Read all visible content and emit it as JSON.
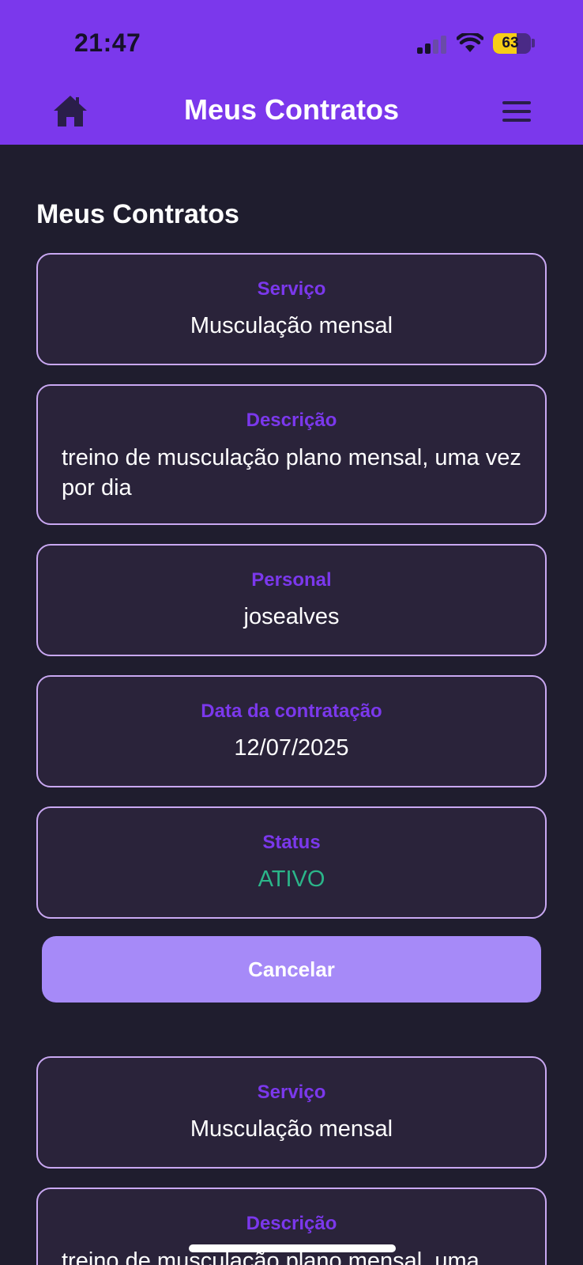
{
  "status_bar": {
    "time": "21:47",
    "battery": "63",
    "battery_level": 0.63
  },
  "header": {
    "title": "Meus Contratos",
    "home_icon": "home-icon",
    "menu_icon": "menu-icon"
  },
  "section_title": "Meus Contratos",
  "colors": {
    "header_bg": "#7B38EC",
    "page_bg": "#1F1D2E",
    "card_bg": "#2A233A",
    "card_border": "#C9A8F2",
    "label": "#7B38EC",
    "status_active": "#2BB589",
    "cancel_button": "#A68AF8"
  },
  "contracts": [
    {
      "service_label": "Serviço",
      "service": "Musculação mensal",
      "description_label": "Descrição",
      "description": "treino de musculação plano mensal, uma vez por dia",
      "personal_label": "Personal",
      "personal": "josealves",
      "date_label": "Data da contratação",
      "date": "12/07/2025",
      "status_label": "Status",
      "status": "ATIVO",
      "cancel_label": "Cancelar"
    },
    {
      "service_label": "Serviço",
      "service": "Musculação mensal",
      "description_label": "Descrição",
      "description": "treino de musculação plano mensal, uma"
    }
  ]
}
